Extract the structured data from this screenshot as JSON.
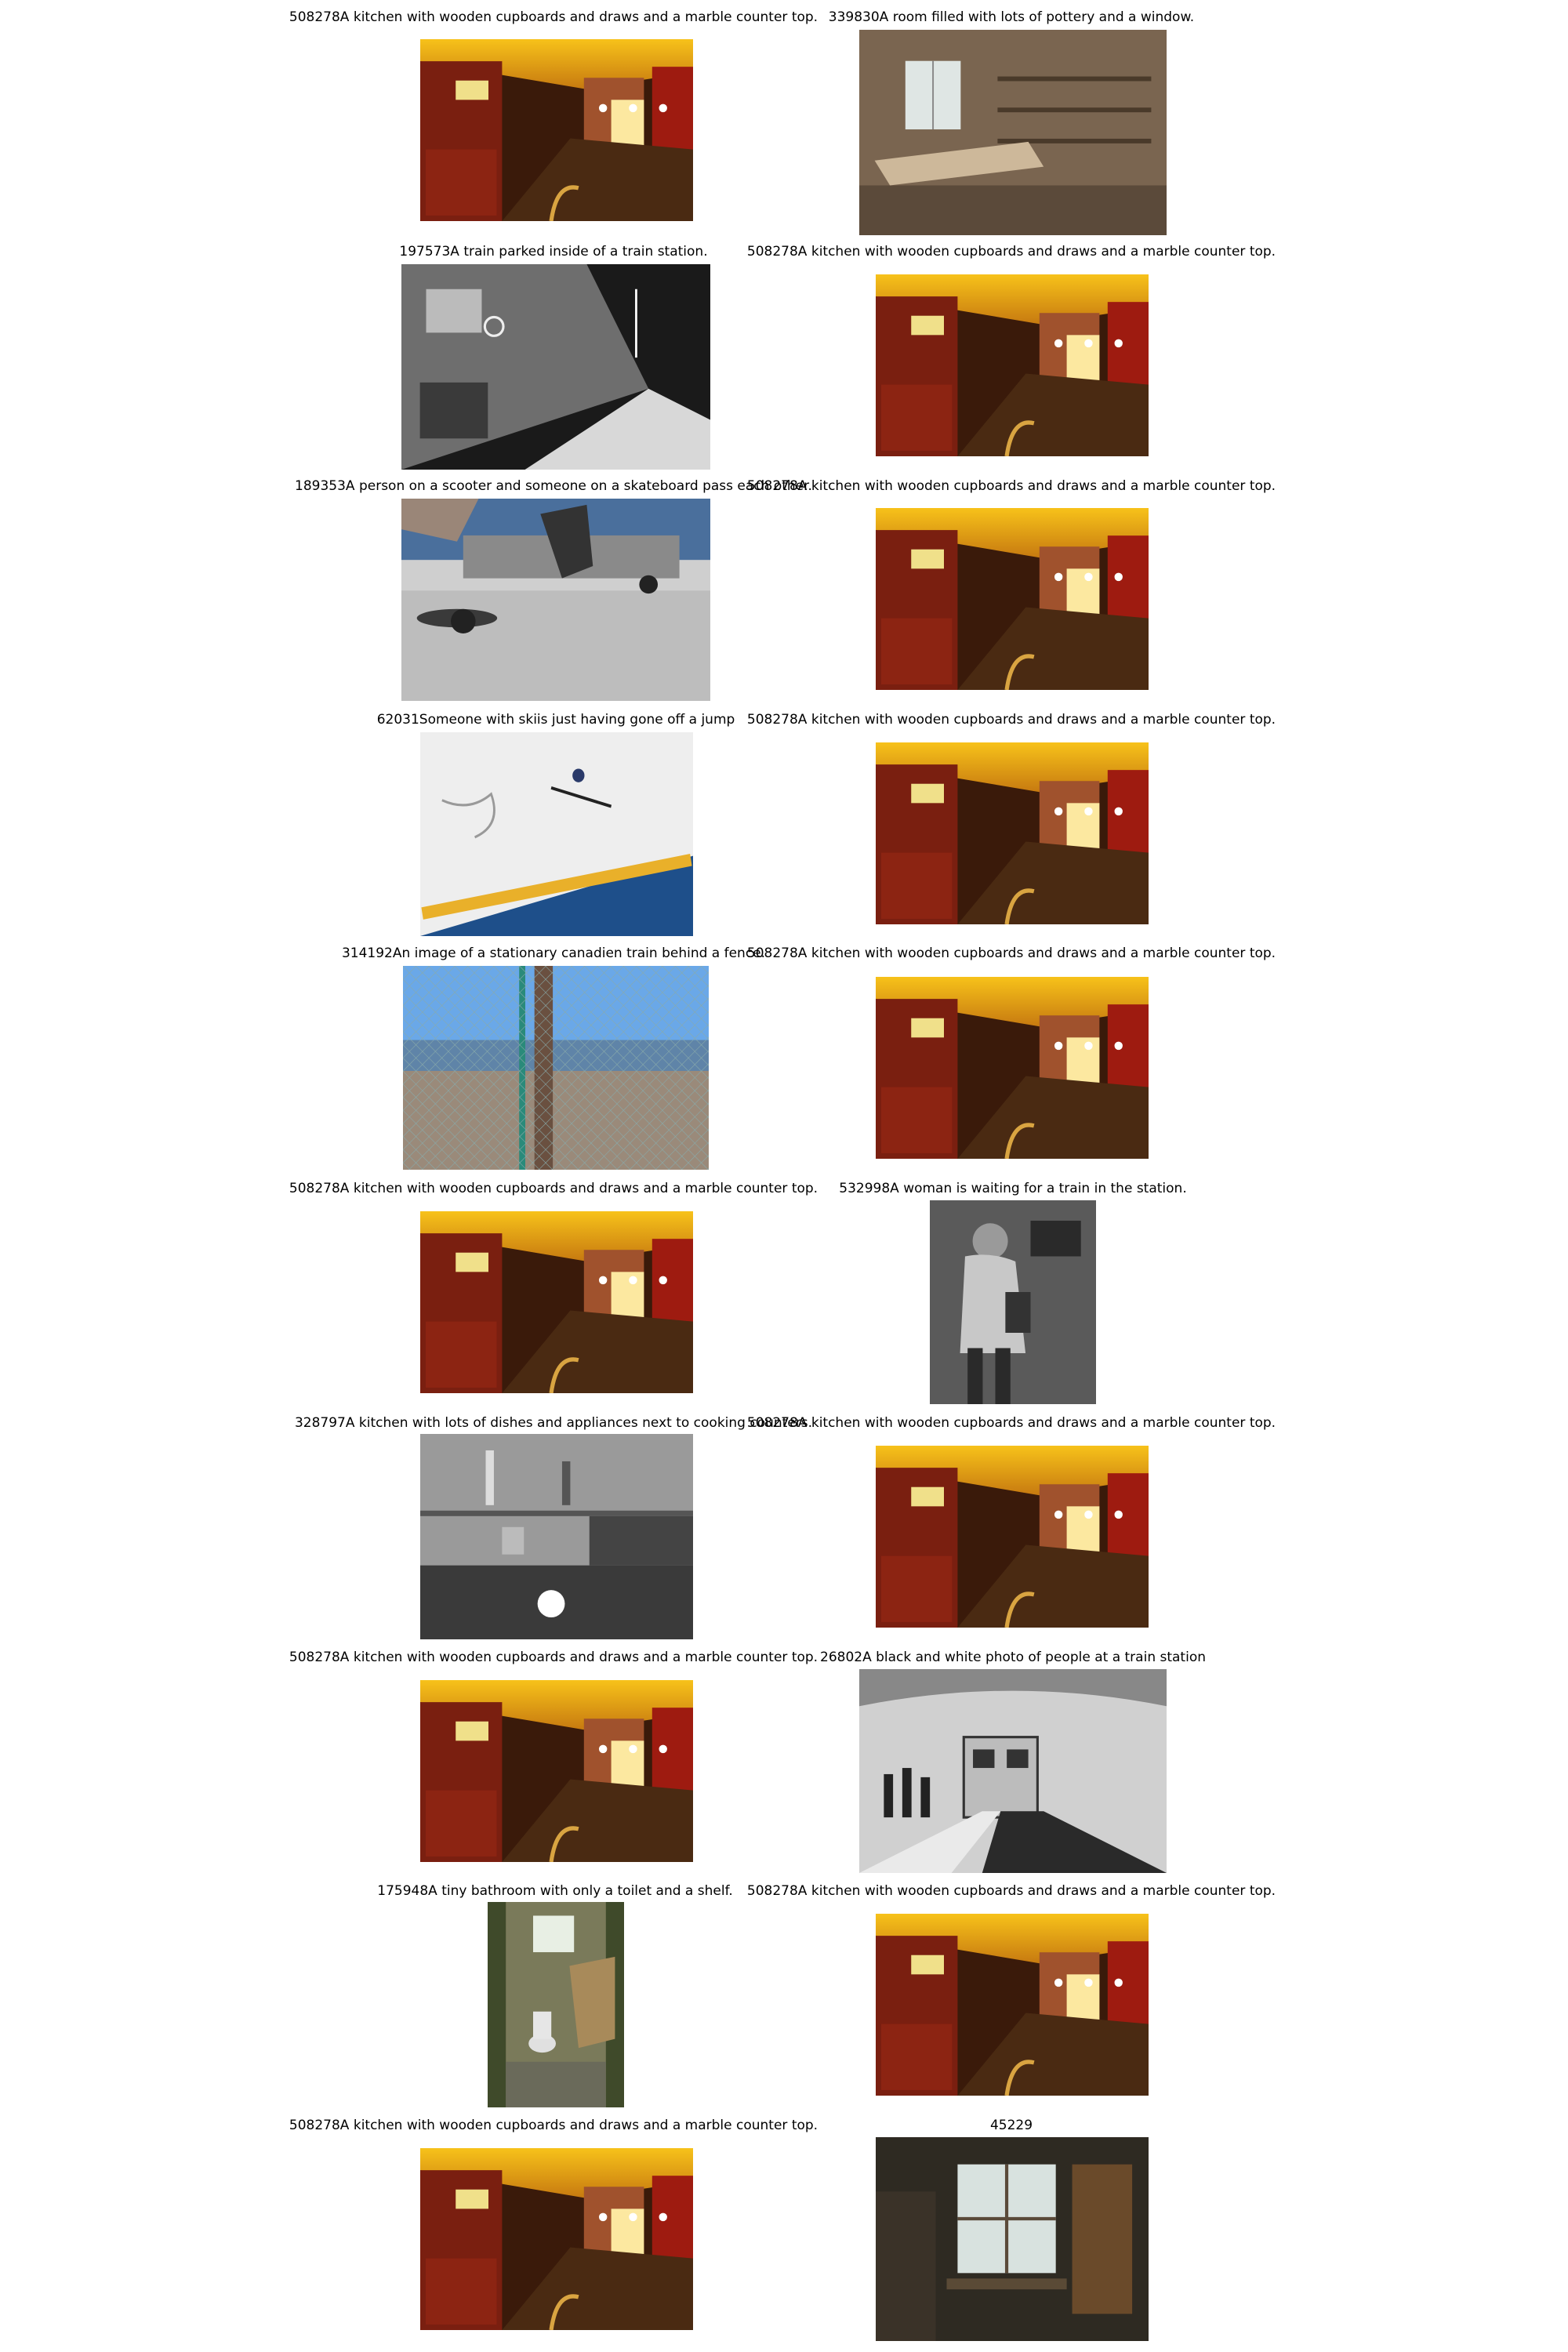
{
  "cells": [
    {
      "id": "c0",
      "caption": "508278A kitchen with wooden cupboards and draws and a marble counter top.",
      "scene": "kitchen"
    },
    {
      "id": "c1",
      "caption": "339830A room filled with lots of pottery and a window.",
      "scene": "pottery"
    },
    {
      "id": "c2",
      "caption": "197573A train parked inside of a train station.",
      "scene": "train-bw"
    },
    {
      "id": "c3",
      "caption": "508278A kitchen with wooden cupboards and draws and a marble counter top.",
      "scene": "kitchen"
    },
    {
      "id": "c4",
      "caption": "189353A person on a scooter and someone on a skateboard pass each other.",
      "scene": "skate"
    },
    {
      "id": "c5",
      "caption": "508278A kitchen with wooden cupboards and draws and a marble counter top.",
      "scene": "kitchen"
    },
    {
      "id": "c6",
      "caption": "62031Someone with skiis just having gone off a jump",
      "scene": "ski"
    },
    {
      "id": "c7",
      "caption": "508278A kitchen with wooden cupboards and draws and a marble counter top.",
      "scene": "kitchen"
    },
    {
      "id": "c8",
      "caption": "314192An image of a stationary canadien train behind a fence.",
      "scene": "fence"
    },
    {
      "id": "c9",
      "caption": "508278A kitchen with wooden cupboards and draws and a marble counter top.",
      "scene": "kitchen"
    },
    {
      "id": "c10",
      "caption": "508278A kitchen with wooden cupboards and draws and a marble counter top.",
      "scene": "kitchen"
    },
    {
      "id": "c11",
      "caption": "532998A woman is waiting for a train in the station.",
      "scene": "woman"
    },
    {
      "id": "c12",
      "caption": "328797A kitchen with lots of dishes and appliances next to cooking counters.",
      "scene": "dishes"
    },
    {
      "id": "c13",
      "caption": "508278A kitchen with wooden cupboards and draws and a marble counter top.",
      "scene": "kitchen"
    },
    {
      "id": "c14",
      "caption": "508278A kitchen with wooden cupboards and draws and a marble counter top.",
      "scene": "kitchen"
    },
    {
      "id": "c15",
      "caption": "26802A black and white photo of people at a train station",
      "scene": "subway"
    },
    {
      "id": "c16",
      "caption": "175948A tiny bathroom with only a toilet and a shelf.",
      "scene": "bathroom"
    },
    {
      "id": "c17",
      "caption": "508278A kitchen with wooden cupboards and draws and a marble counter top.",
      "scene": "kitchen"
    },
    {
      "id": "c18",
      "caption": "508278A kitchen with wooden cupboards and draws and a marble counter top.",
      "scene": "kitchen"
    },
    {
      "id": "c19",
      "caption": "45229",
      "scene": "window-room"
    }
  ]
}
